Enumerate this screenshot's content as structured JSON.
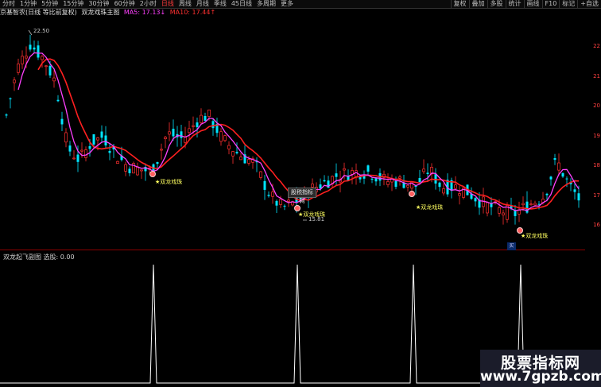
{
  "toolbar": {
    "items": [
      "分时",
      "1分钟",
      "5分钟",
      "15分钟",
      "30分钟",
      "60分钟",
      "2小时",
      "日线",
      "周线",
      "月线",
      "季线",
      "45日线",
      "多周期",
      "更多"
    ],
    "active_index": 7,
    "right_items": [
      "复权",
      "叠加",
      "多股",
      "统计",
      "画线",
      "F10",
      "标记",
      "+自选"
    ]
  },
  "info": {
    "stock": "京基智农(日线 等比前复权)",
    "main_name": "双龙戏珠主图",
    "ma5": "MA5: 17.13↓",
    "ma10": "MA10: 17.44↑"
  },
  "sub_info": "双龙起飞副图  选股: 0.00",
  "price_axis": [
    "22",
    "21",
    "20",
    "19",
    "18",
    "17",
    "16"
  ],
  "annotations": {
    "high": "22.50",
    "low": "15.81",
    "tooltip": "股税指标网",
    "signal": "★双龙戏珠",
    "buy": "买"
  },
  "watermark": {
    "cn": "股票指标网",
    "url": "www.7gpzb.com"
  },
  "colors": {
    "up": "#ff3030",
    "down": "#00e5ff",
    "ma5": "#ff40ff",
    "ma10": "#ff2020",
    "signal": "#ffff60"
  }
}
